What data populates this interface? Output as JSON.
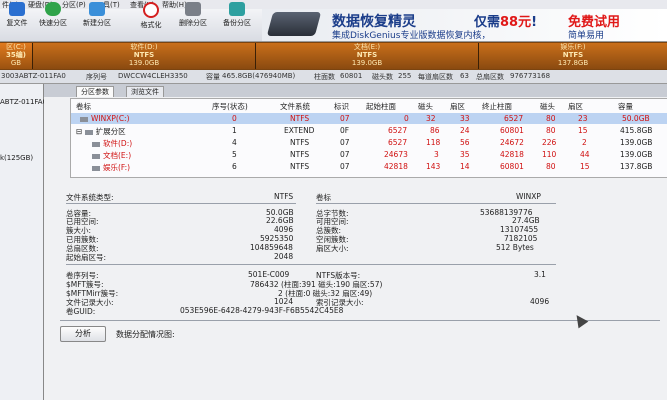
{
  "menu": [
    "件(F)",
    "硬盘(D)",
    "分区(P)",
    "工具(T)",
    "查看(V)",
    "帮助(H)"
  ],
  "toolbar": [
    {
      "label": "复文件",
      "icon": "recover-file-icon",
      "color": "#2a6fd0"
    },
    {
      "label": "快速分区",
      "icon": "quick-partition-icon",
      "color": "#2fa34a"
    },
    {
      "label": "新建分区",
      "icon": "new-partition-icon",
      "color": "#3a8fd9"
    },
    {
      "label": "格式化",
      "icon": "format-icon",
      "color": "#d42020"
    },
    {
      "label": "删除分区",
      "icon": "delete-partition-icon",
      "color": "#7a7f88"
    },
    {
      "label": "备份分区",
      "icon": "backup-partition-icon",
      "color": "#2ea0a0"
    }
  ],
  "banner": {
    "title": "数据恢复精灵",
    "sub": "集成DiskGenius专业版数据恢复内核，",
    "price_prefix": "仅需",
    "price_num": "88元",
    "price_suffix": "!",
    "trial": "免费试用",
    "simple": "简单易用"
  },
  "disk_map": [
    {
      "name": "区(C:)",
      "fs": "35编)",
      "size": "GB"
    },
    {
      "name": "软件(D:)",
      "fs": "NTFS",
      "size": "139.0GB"
    },
    {
      "name": "文档(E:)",
      "fs": "NTFS",
      "size": "139.0GB"
    },
    {
      "name": "娱乐(F:)",
      "fs": "NTFS",
      "size": "137.8GB"
    }
  ],
  "disk_info": {
    "model": "3003ABTZ-011FA0",
    "serial_label": "序列号",
    "serial": "DWCCW4CLEH3350",
    "capacity_label": "容量",
    "capacity": "465.8GB(476940MB)",
    "cyl_label": "柱面数",
    "cyl": "60801",
    "heads_label": "磁头数",
    "heads": "255",
    "spt_label": "每道扇区数",
    "spt": "63",
    "total_label": "总扇区数",
    "total": "976773168"
  },
  "left_tree": [
    "ABTZ-011FA0",
    "k(125GB)"
  ],
  "tabs": [
    "分区参数",
    "浏览文件"
  ],
  "table": {
    "headers": [
      "卷标",
      "序号(状态)",
      "文件系统",
      "标识",
      "起始柱面",
      "磁头",
      "扇区",
      "终止柱面",
      "磁头",
      "扇区",
      "容量"
    ],
    "rows": [
      {
        "label": "WINXP(C:)",
        "num": "0",
        "fs": "NTFS",
        "id": "07",
        "sc": "0",
        "sh": "32",
        "ss": "33",
        "ec": "6527",
        "eh": "80",
        "es": "23",
        "cap": "50.0GB",
        "color": "red",
        "indent": 0
      },
      {
        "label": "扩展分区",
        "num": "1",
        "fs": "EXTEND",
        "id": "0F",
        "sc": "6527",
        "sh": "86",
        "ss": "24",
        "ec": "60801",
        "eh": "80",
        "es": "15",
        "cap": "415.8GB",
        "color": "dark",
        "indent": 1
      },
      {
        "label": "软件(D:)",
        "num": "4",
        "fs": "NTFS",
        "id": "07",
        "sc": "6527",
        "sh": "118",
        "ss": "56",
        "ec": "24672",
        "eh": "226",
        "es": "2",
        "cap": "139.0GB",
        "color": "red",
        "indent": 2
      },
      {
        "label": "文档(E:)",
        "num": "5",
        "fs": "NTFS",
        "id": "07",
        "sc": "24673",
        "sh": "3",
        "ss": "35",
        "ec": "42818",
        "eh": "110",
        "es": "44",
        "cap": "139.0GB",
        "color": "red",
        "indent": 2
      },
      {
        "label": "娱乐(F:)",
        "num": "6",
        "fs": "NTFS",
        "id": "07",
        "sc": "42818",
        "sh": "143",
        "ss": "14",
        "ec": "60801",
        "eh": "80",
        "es": "15",
        "cap": "137.8GB",
        "color": "red",
        "indent": 2
      }
    ]
  },
  "details": {
    "fs_type_label": "文件系统类型:",
    "fs_type": "NTFS",
    "vol_label_label": "卷标",
    "vol_label": "WINXP",
    "left": [
      {
        "label": "总容量:",
        "value": "50.0GB"
      },
      {
        "label": "已用空间:",
        "value": "22.6GB"
      },
      {
        "label": "簇大小:",
        "value": "4096"
      },
      {
        "label": "已用簇数:",
        "value": "5925350"
      },
      {
        "label": "总扇区数:",
        "value": "104859648"
      },
      {
        "label": "起始扇区号:",
        "value": "2048"
      }
    ],
    "right": [
      {
        "label": "总字节数:",
        "value": "53688139776"
      },
      {
        "label": "可用空间:",
        "value": "27.4GB"
      },
      {
        "label": "总簇数:",
        "value": "13107455"
      },
      {
        "label": "空闲簇数:",
        "value": "7182105"
      },
      {
        "label": "扇区大小:",
        "value": "512 Bytes"
      }
    ],
    "serial_label": "卷序列号:",
    "serial": "501E-C009",
    "ntfs_ver_label": "NTFS版本号:",
    "ntfs_ver": "3.1",
    "mft_label": "$MFT簇号:",
    "mft": "786432 (柱面:391 磁头:190 扇区:57)",
    "mftmirr_label": "$MFTMirr簇号:",
    "mftmirr": "2 (柱面:0 磁头:32 扇区:49)",
    "rec_label": "文件记录大小:",
    "rec": "1024",
    "idx_label": "索引记录大小:",
    "idx": "4096",
    "guid_label": "卷GUID:",
    "guid": "053E596E-6428-4279-943F-F6B5542C45E8"
  },
  "footer": {
    "analyze": "分析",
    "dist": "数据分配情况图:"
  }
}
